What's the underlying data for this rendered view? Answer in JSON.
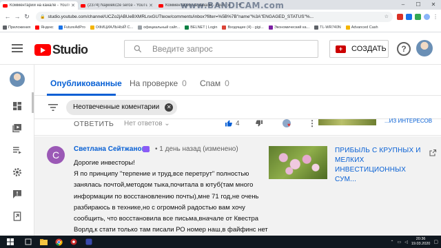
{
  "browser": {
    "tabs": [
      {
        "title": "Комментарии на канале - YouTube",
        "active": true
      },
      {
        "title": "(2374) Najwiekcze serce - YouTube",
        "active": false
      },
      {
        "title": "Комментарии на канале - YouTub",
        "active": false
      }
    ],
    "url": "studio.youtube.com/channel/UCZo2jABUeBXMRLnxGUTtecw/comments/inbox?filter=%5B%7B\"name\"%3A\"ENGAGED_STATUS\"%..."
  },
  "watermark": "www.BANDICAM.com",
  "bookmarks": [
    {
      "label": "Приложения",
      "color": "#5f6368"
    },
    {
      "label": "Яндекс",
      "color": "#ff0000"
    },
    {
      "label": "FutureAdPro",
      "color": "#1a73e8"
    },
    {
      "label": "ОФИЦИАЛЬНЫЙ С...",
      "color": "#f4b400"
    },
    {
      "label": "официальный сайт...",
      "color": "#9aa0a6"
    },
    {
      "label": "BELNET | Login",
      "color": "#0b8043"
    },
    {
      "label": "Входящие (4) - gigi...",
      "color": "#db4437"
    },
    {
      "label": "Экономический ка...",
      "color": "#7b1fa2"
    },
    {
      "label": "TL-WR740N",
      "color": "#5f6368"
    },
    {
      "label": "Advanced Cash",
      "color": "#f4b400"
    }
  ],
  "header": {
    "logo_text": "Studio",
    "search_placeholder": "Введите запрос",
    "create_label": "СОЗДАТЬ",
    "help_label": "?"
  },
  "tabs": [
    {
      "label": "Опубликованные",
      "count": "",
      "active": true
    },
    {
      "label": "На проверке",
      "count": "0",
      "active": false
    },
    {
      "label": "Спам",
      "count": "0",
      "active": false
    }
  ],
  "filter": {
    "chip_label": "Неотвеченные коментарии"
  },
  "previous_comment": {
    "reply_label": "ОТВЕТИТЬ",
    "no_replies_label": "Нет ответов",
    "likes": "4",
    "video_title_fragment": "...ИЗ ИНТЕРЕСОВ"
  },
  "comment": {
    "avatar_letter": "С",
    "author": "Светлана Сейтжанова",
    "meta": "• 1 день назад (изменено)",
    "lines": [
      "Дорогие инвесторы!",
      "Я по принципу \"терпение и труд,все перетрут\" полностью",
      "занялась почтой,методом тыка,почитала в ютуб(там много",
      "информации по восстановлению почты),мне 71 год,не очень",
      "разбираюсь в технике,но с огромной радостью вам хочу",
      "сообщить, что восстановила все письма,вначале от Квестра",
      "Ворлд,к стати только там писали РО номер наш,в файфинс нет"
    ],
    "video_title_lines": [
      "ПРИБЫЛЬ С КРУПНЫХ И",
      "МЕЛКИХ",
      "ИНВЕСТИЦИОННЫХ СУМ..."
    ]
  },
  "taskbar": {
    "clock_time": "20:36",
    "clock_date": "19.03.2020"
  },
  "colors": {
    "accent": "#065fd4",
    "youtube_red": "#ff0000",
    "avatar_purple": "#9b59b6"
  }
}
